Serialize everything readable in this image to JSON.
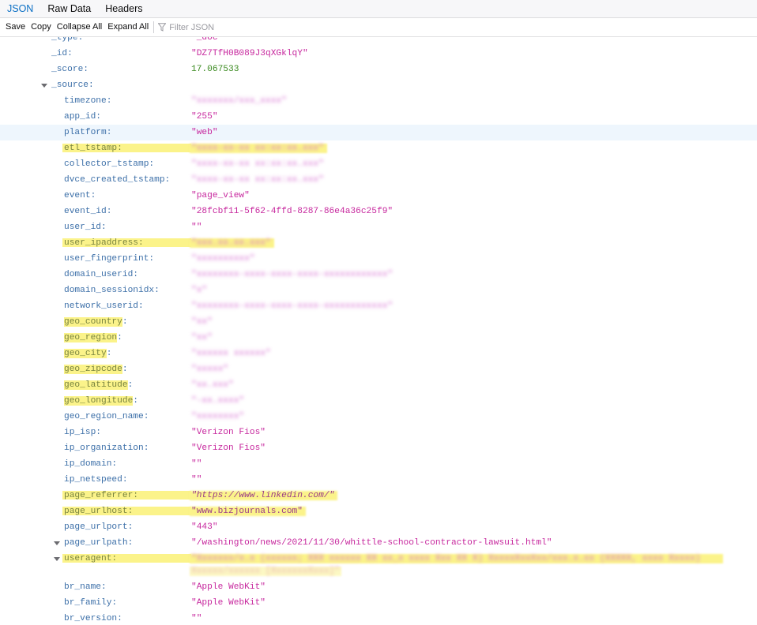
{
  "tabs": [
    {
      "label": "JSON",
      "active": true
    },
    {
      "label": "Raw Data",
      "active": false
    },
    {
      "label": "Headers",
      "active": false
    }
  ],
  "toolbar": {
    "save_label": "Save",
    "copy_label": "Copy",
    "collapse_label": "Collapse All",
    "expand_label": "Expand All",
    "filter_placeholder": "Filter JSON",
    "filter_value": ""
  },
  "colors": {
    "key": "#3c6fa8",
    "string": "#c7289e",
    "number": "#3a8a1f",
    "highlight": "#fbf38a",
    "active_tab": "#0a6fc4",
    "hover_row": "#eef6fd"
  },
  "rows": [
    {
      "key": "_type:",
      "value": "\"_doc\"",
      "indent": 1,
      "partial": true
    },
    {
      "key": "_id:",
      "value": "\"DZ7TfH0B089J3qXGklqY\"",
      "indent": 1
    },
    {
      "key": "_score:",
      "value": "17.067533",
      "indent": 1,
      "type": "number"
    },
    {
      "key": "_source:",
      "value": "",
      "indent": 1,
      "expandable": true
    },
    {
      "key": "timezone:",
      "value": "\"xxxxxxx/xxx_xxxx\"",
      "indent": 2,
      "blurred": true
    },
    {
      "key": "app_id:",
      "value": "\"255\"",
      "indent": 2
    },
    {
      "key": "platform:",
      "value": "\"web\"",
      "indent": 2,
      "hovered": true
    },
    {
      "key": "etl_tstamp:",
      "value": "\"xxxx-xx-xx xx:xx:xx.xxx\"",
      "indent": 2,
      "blurred": true,
      "highlighted": "full"
    },
    {
      "key": "collector_tstamp:",
      "value": "\"xxxx-xx-xx xx:xx:xx.xxx\"",
      "indent": 2,
      "blurred": true
    },
    {
      "key": "dvce_created_tstamp:",
      "value": "\"xxxx-xx-xx xx:xx:xx.xxx\"",
      "indent": 2,
      "blurred": true
    },
    {
      "key": "event:",
      "value": "\"page_view\"",
      "indent": 2
    },
    {
      "key": "event_id:",
      "value": "\"28fcbf11-5f62-4ffd-8287-86e4a36c25f9\"",
      "indent": 2
    },
    {
      "key": "user_id:",
      "value": "\"\"",
      "indent": 2
    },
    {
      "key": "user_ipaddress:",
      "value": "\"xxx.xx.xx.xxx\"",
      "indent": 2,
      "blurred": true,
      "highlighted": "full"
    },
    {
      "key": "user_fingerprint:",
      "value": "\"xxxxxxxxxx\"",
      "indent": 2,
      "blurred": true
    },
    {
      "key": "domain_userid:",
      "value": "\"xxxxxxxx-xxxx-xxxx-xxxx-xxxxxxxxxxxx\"",
      "indent": 2,
      "blurred": true
    },
    {
      "key": "domain_sessionidx:",
      "value": "\"x\"",
      "indent": 2,
      "blurred": true
    },
    {
      "key": "network_userid:",
      "value": "\"xxxxxxxx-xxxx-xxxx-xxxx-xxxxxxxxxxxx\"",
      "indent": 2,
      "blurred": true
    },
    {
      "key": "geo_country:",
      "value": "\"xx\"",
      "indent": 2,
      "blurred": true,
      "highlighted": "key"
    },
    {
      "key": "geo_region:",
      "value": "\"xx\"",
      "indent": 2,
      "blurred": true,
      "highlighted": "key"
    },
    {
      "key": "geo_city:",
      "value": "\"xxxxxx xxxxxx\"",
      "indent": 2,
      "blurred": true,
      "highlighted": "key"
    },
    {
      "key": "geo_zipcode:",
      "value": "\"xxxxx\"",
      "indent": 2,
      "blurred": true,
      "highlighted": "key"
    },
    {
      "key": "geo_latitude:",
      "value": "\"xx.xxx\"",
      "indent": 2,
      "blurred": true,
      "highlighted": "key"
    },
    {
      "key": "geo_longitude:",
      "value": "\"-xx.xxxx\"",
      "indent": 2,
      "blurred": true,
      "highlighted": "key"
    },
    {
      "key": "geo_region_name:",
      "value": "\"xxxxxxxx\"",
      "indent": 2,
      "blurred": true
    },
    {
      "key": "ip_isp:",
      "value": "\"Verizon Fios\"",
      "indent": 2
    },
    {
      "key": "ip_organization:",
      "value": "\"Verizon Fios\"",
      "indent": 2
    },
    {
      "key": "ip_domain:",
      "value": "\"\"",
      "indent": 2
    },
    {
      "key": "ip_netspeed:",
      "value": "\"\"",
      "indent": 2
    },
    {
      "key": "page_referrer:",
      "value": "\"https://www.linkedin.com/\"",
      "indent": 2,
      "highlighted": "full",
      "italic": true
    },
    {
      "key": "page_urlhost:",
      "value": "\"www.bizjournals.com\"",
      "indent": 2,
      "highlighted": "full"
    },
    {
      "key": "page_urlport:",
      "value": "\"443\"",
      "indent": 2
    },
    {
      "key": "page_urlpath:",
      "value": "\"/washington/news/2021/11/30/whittle-school-contractor-lawsuit.html\"",
      "indent": 2,
      "expandable": true
    },
    {
      "key": "useragent:",
      "value": "\"Xxxxxxx/x.x (xxxxxx; XXX xxxxxx XX xx_x xxxx Xxx XX X) XxxxxXxxXxx/xxx.x.xx (XXXXX, xxxx Xxxxx)",
      "value_line2": "Xxxxxx/xxxxxx [XxxxxxxXxxx]\"",
      "indent": 2,
      "expandable": true,
      "blurred": true,
      "highlighted": "full",
      "wrapped": true
    },
    {
      "key": "br_name:",
      "value": "\"Apple WebKit\"",
      "indent": 2
    },
    {
      "key": "br_family:",
      "value": "\"Apple WebKit\"",
      "indent": 2
    },
    {
      "key": "br_version:",
      "value": "\"\"",
      "indent": 2
    }
  ]
}
